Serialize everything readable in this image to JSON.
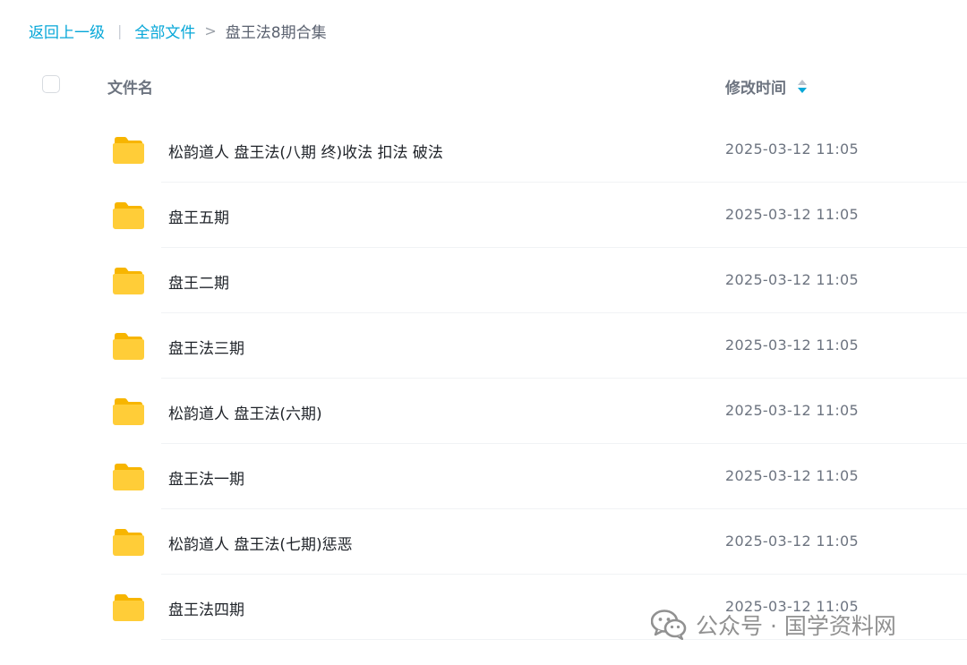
{
  "breadcrumb": {
    "back": "返回上一级",
    "separator_bar": "|",
    "all_files": "全部文件",
    "separator_arrow": ">",
    "current": "盘王法8期合集"
  },
  "header": {
    "name_label": "文件名",
    "time_label": "修改时间"
  },
  "files": [
    {
      "name": "松韵道人 盘王法(八期 终)收法 扣法 破法",
      "modified": "2025-03-12 11:05"
    },
    {
      "name": "盘王五期",
      "modified": "2025-03-12 11:05"
    },
    {
      "name": "盘王二期",
      "modified": "2025-03-12 11:05"
    },
    {
      "name": "盘王法三期",
      "modified": "2025-03-12 11:05"
    },
    {
      "name": "松韵道人 盘王法(六期)",
      "modified": "2025-03-12 11:05"
    },
    {
      "name": "盘王法一期",
      "modified": "2025-03-12 11:05"
    },
    {
      "name": "松韵道人 盘王法(七期)惩恶",
      "modified": "2025-03-12 11:05"
    },
    {
      "name": "盘王法四期",
      "modified": "2025-03-12 11:05"
    }
  ],
  "watermark": {
    "text": "公众号 · 国学资料网",
    "icon": "wechat-icon"
  },
  "colors": {
    "accent": "#06a7d8",
    "folder": "#ffc933",
    "text_primary": "#1f2329",
    "text_secondary": "#6d7480"
  }
}
